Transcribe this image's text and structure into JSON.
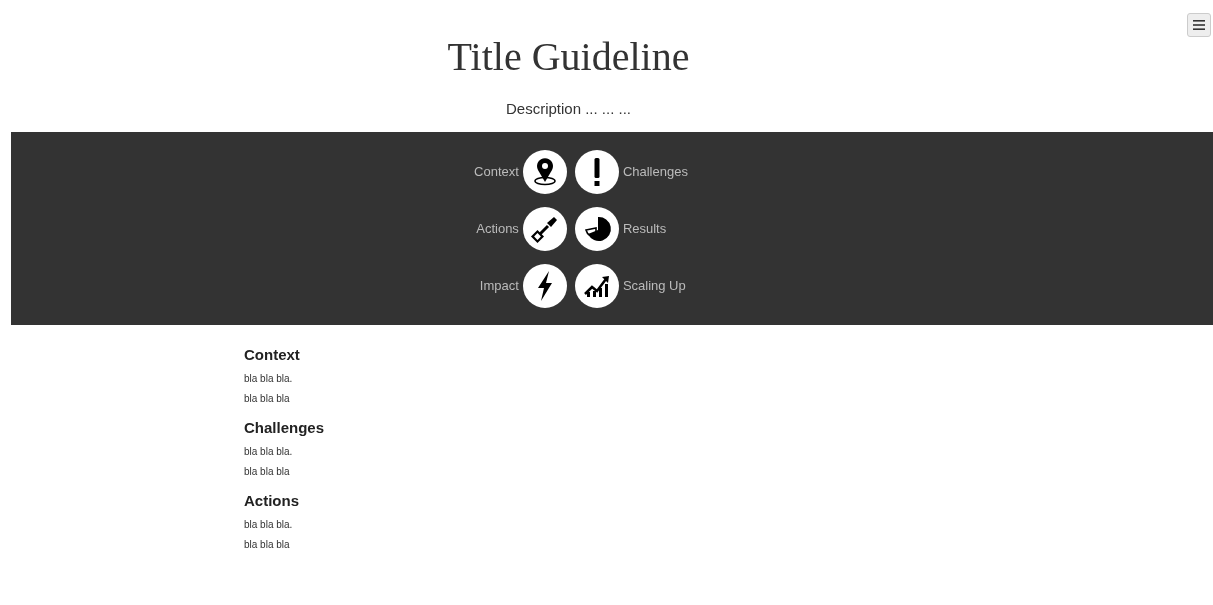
{
  "title": "Title Guideline",
  "description": "Description ... ... ...",
  "nav": [
    {
      "label": "Context"
    },
    {
      "label": "Challenges"
    },
    {
      "label": "Actions"
    },
    {
      "label": "Results"
    },
    {
      "label": "Impact"
    },
    {
      "label": "Scaling Up"
    }
  ],
  "sections": [
    {
      "heading": "Context",
      "paragraphs": [
        "bla bla bla.",
        "bla bla bla"
      ]
    },
    {
      "heading": "Challenges",
      "paragraphs": [
        "bla bla bla.",
        "bla bla bla"
      ]
    },
    {
      "heading": "Actions",
      "paragraphs": [
        "bla bla bla.",
        "bla bla bla"
      ]
    }
  ]
}
